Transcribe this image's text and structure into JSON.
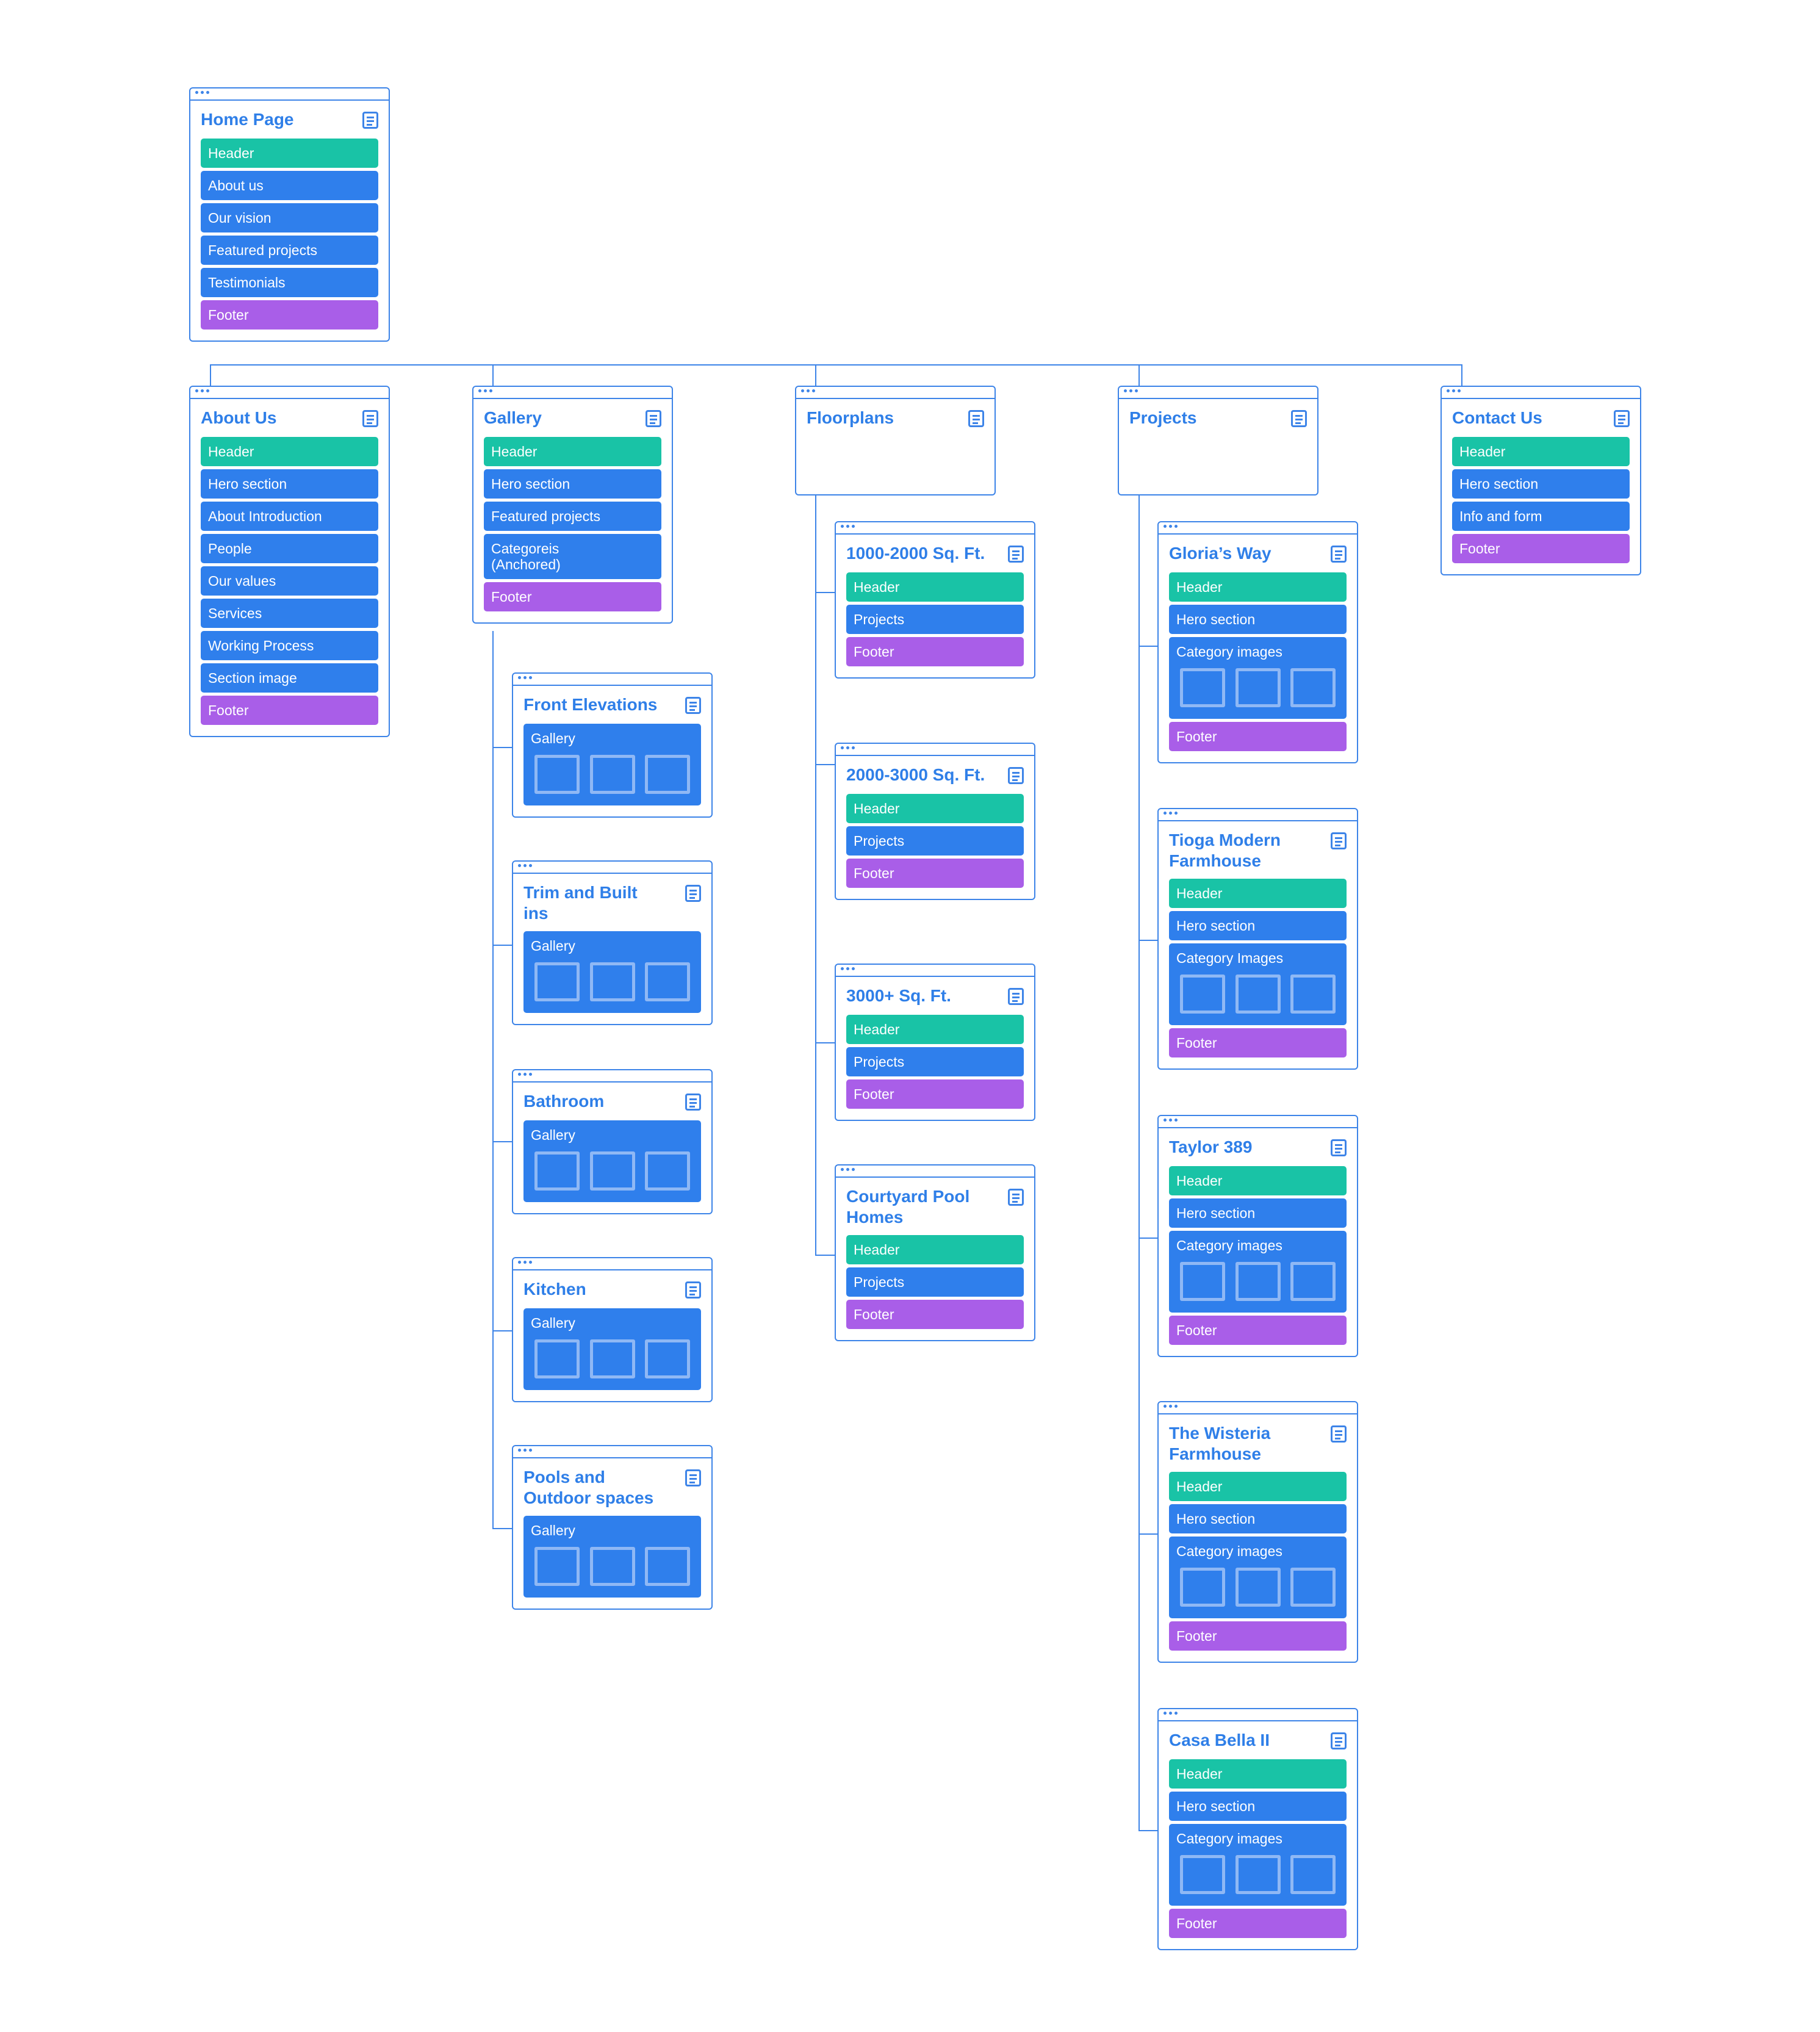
{
  "colors": {
    "accent": "#3d84e8",
    "header_section": "#19c3a6",
    "body_section": "#2f7fec",
    "footer_section": "#a95ee8",
    "thumbnail_outline": "#8fb8f5"
  },
  "root": {
    "title": "Home Page",
    "sections": [
      "Header",
      "About us",
      "Our vision",
      "Featured projects",
      "Testimonials",
      "Footer"
    ]
  },
  "pages": [
    {
      "title": "About Us",
      "sections": [
        "Header",
        "Hero section",
        "About Introduction",
        "People",
        "Our values",
        "Services",
        "Working Process",
        "Section image",
        "Footer"
      ]
    },
    {
      "title": "Gallery",
      "sections": [
        "Header",
        "Hero section",
        "Featured projects",
        "Categoreis (Anchored)",
        "Footer"
      ],
      "children": [
        {
          "title": "Front Elevations",
          "gallery_label": "Gallery"
        },
        {
          "title": "Trim and Built ins",
          "gallery_label": "Gallery"
        },
        {
          "title": "Bathroom",
          "gallery_label": "Gallery"
        },
        {
          "title": "Kitchen",
          "gallery_label": "Gallery"
        },
        {
          "title": "Pools and Outdoor spaces",
          "gallery_label": "Gallery"
        }
      ]
    },
    {
      "title": "Floorplans",
      "sections": [],
      "children": [
        {
          "title": "1000-2000 Sq. Ft.",
          "sections": [
            "Header",
            "Projects",
            "Footer"
          ]
        },
        {
          "title": "2000-3000 Sq. Ft.",
          "sections": [
            "Header",
            "Projects",
            "Footer"
          ]
        },
        {
          "title": "3000+ Sq. Ft.",
          "sections": [
            "Header",
            "Projects",
            "Footer"
          ]
        },
        {
          "title": "Courtyard Pool Homes",
          "sections": [
            "Header",
            "Projects",
            "Footer"
          ]
        }
      ]
    },
    {
      "title": "Projects",
      "sections": [],
      "children": [
        {
          "title": "Gloria’s Way",
          "sections": [
            "Header",
            "Hero section"
          ],
          "gallery_label": "Category images",
          "footer": "Footer"
        },
        {
          "title": "Tioga Modern Farmhouse",
          "sections": [
            "Header",
            "Hero section"
          ],
          "gallery_label": "Category Images",
          "footer": "Footer"
        },
        {
          "title": "Taylor 389",
          "sections": [
            "Header",
            "Hero section"
          ],
          "gallery_label": "Category images",
          "footer": "Footer"
        },
        {
          "title": "The Wisteria Farmhouse",
          "sections": [
            "Header",
            "Hero section"
          ],
          "gallery_label": "Category images",
          "footer": "Footer"
        },
        {
          "title": "Casa Bella II",
          "sections": [
            "Header",
            "Hero section"
          ],
          "gallery_label": "Category images",
          "footer": "Footer"
        }
      ]
    },
    {
      "title": "Contact Us",
      "sections": [
        "Header",
        "Hero section",
        "Info and form",
        "Footer"
      ]
    }
  ]
}
